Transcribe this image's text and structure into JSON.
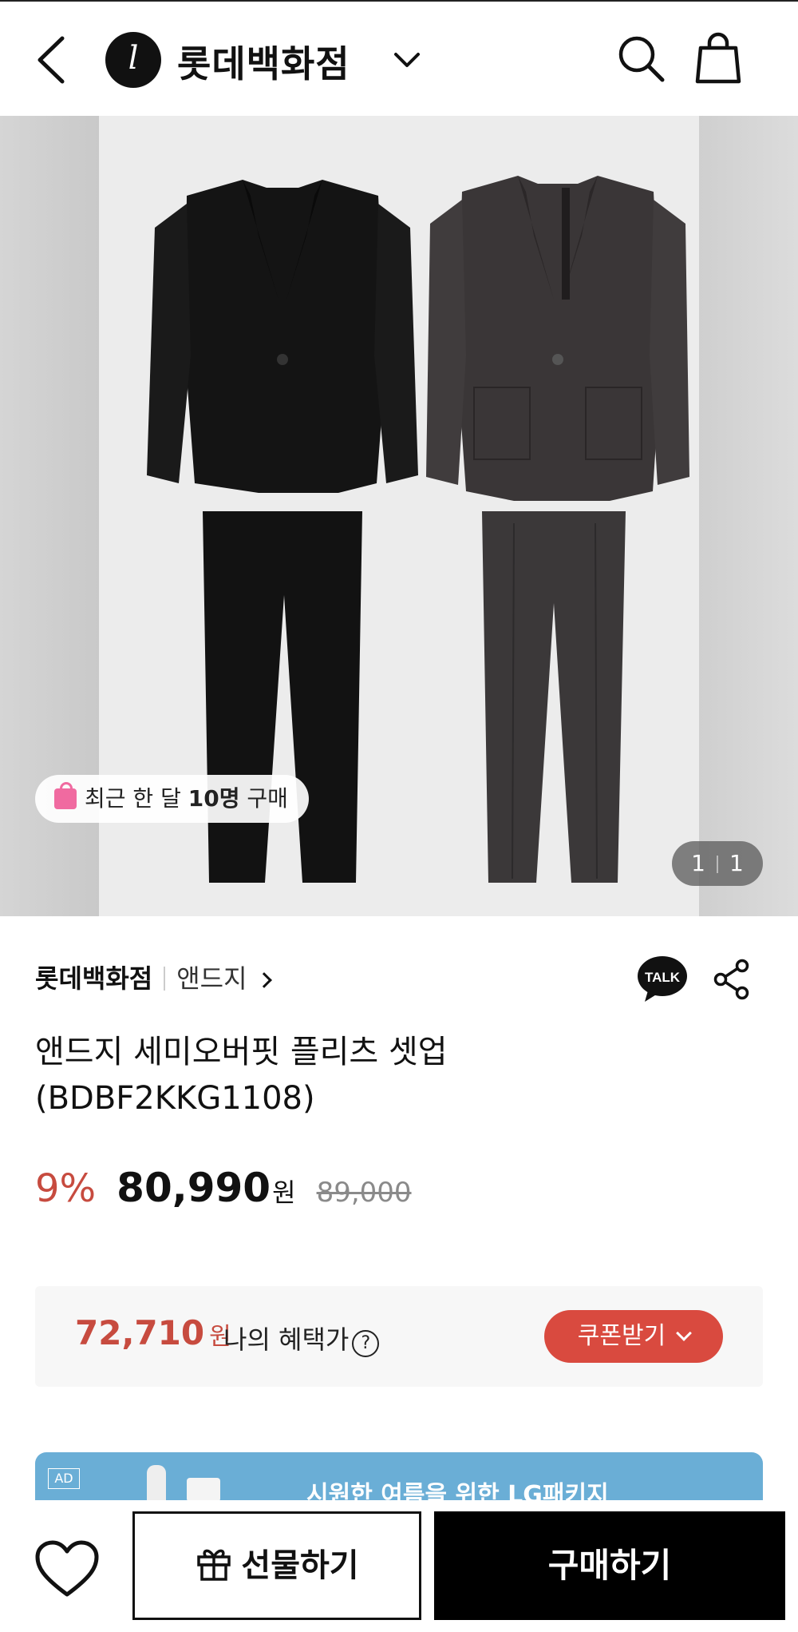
{
  "header": {
    "brand_title": "롯데백화점",
    "logo_letter": "l",
    "icons": [
      "back-arrow-icon",
      "lotte-logo-icon",
      "chevron-down-icon",
      "search-icon",
      "shopping-bag-icon"
    ]
  },
  "gallery": {
    "buyers_prefix": "최근 한 달 ",
    "buyers_count": "10명",
    "buyers_suffix": " 구매",
    "page_current": "1",
    "page_total": "1"
  },
  "product": {
    "store": "롯데백화점",
    "brand": "앤드지",
    "name_line1": "앤드지 세미오버핏 플리츠 셋업",
    "name_line2": "(BDBF2KKG1108)",
    "discount": "9%",
    "price": "80,990",
    "currency": "원",
    "original_price": "89,000",
    "talk_label": "TALK"
  },
  "benefit": {
    "price": "72,710",
    "currency": "원",
    "label": "나의 혜택가",
    "help": "?",
    "coupon_label": "쿠폰받기"
  },
  "ad": {
    "tag": "AD",
    "text": "시원한 여름을 위한 LG패키지"
  },
  "bottom": {
    "gift_label": "선물하기",
    "buy_label": "구매하기"
  },
  "colors": {
    "accent_red": "#c74b3f",
    "coupon_red": "#d94a3f",
    "ad_blue": "#6aaed6",
    "buy_black": "#000000"
  }
}
